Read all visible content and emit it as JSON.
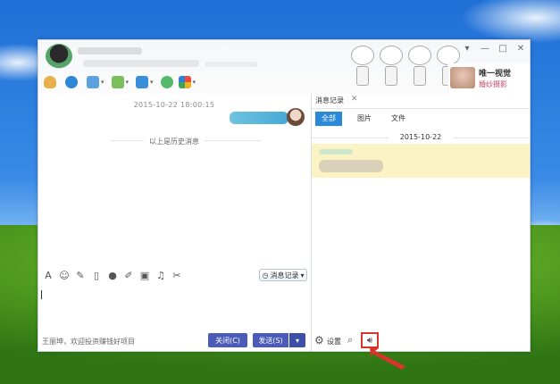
{
  "titlebar": {
    "window_controls": [
      "▾",
      "—",
      "□",
      "✕"
    ],
    "promo_line1": "唯一视觉",
    "promo_line2": "婚纱摄影"
  },
  "chat": {
    "timestamp": "2015-10-22 18:00:15",
    "history_label": "以上是历史消息"
  },
  "input_toolbar": {
    "message_record_label": "消息记录",
    "icons": [
      "font-icon",
      "emoji-icon",
      "wand-icon",
      "screenshot-icon",
      "mic-icon",
      "edit-icon",
      "image-icon",
      "music-icon",
      "scissors-icon"
    ]
  },
  "bottom": {
    "hint": "王丽坤，欢迎投资赚钱好项目",
    "close_label": "关闭(C)",
    "send_label": "发送(S)",
    "send_dropdown": "▾"
  },
  "history_panel": {
    "tab_title": "消息记录",
    "filter_tabs": [
      "全部",
      "图片",
      "文件"
    ],
    "date": "2015-10-22",
    "settings_label": "设置"
  },
  "colors": {
    "accent": "#2a89d8",
    "button": "#4a5bb9",
    "highlight": "#d9342b",
    "message_bg": "#fbf3c4"
  }
}
